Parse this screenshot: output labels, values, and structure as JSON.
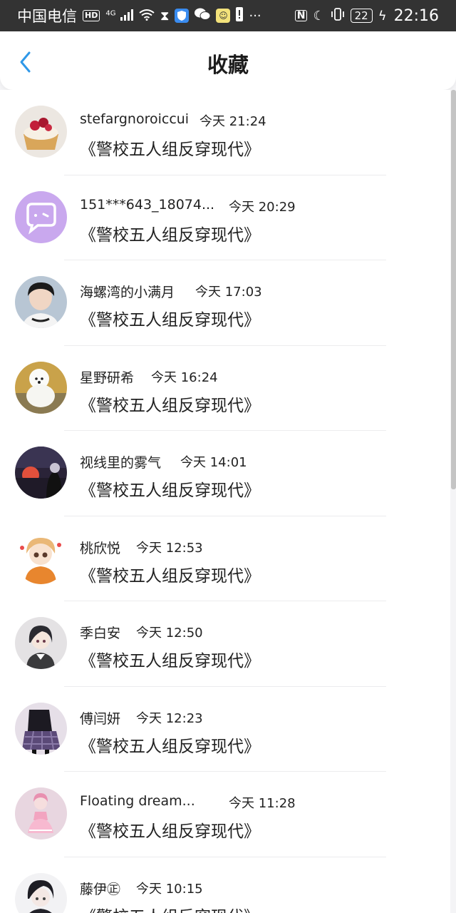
{
  "status_bar": {
    "carrier": "中国电信",
    "hd": "HD",
    "network": "4G",
    "battery": "22",
    "time": "22:16"
  },
  "header": {
    "title": "收藏",
    "back_icon": "chevron-left-icon"
  },
  "favorites": [
    {
      "name": "stefargnoroiccui",
      "time": "今天 21:24",
      "title": "《警校五人组反穿现代》",
      "avatar": "cupcake-avatar"
    },
    {
      "name": "151***643_18074...",
      "time": "今天 20:29",
      "title": "《警校五人组反穿现代》",
      "avatar": "default-chat-avatar"
    },
    {
      "name": "海螺湾的小满月",
      "time": "今天 17:03",
      "title": "《警校五人组反穿现代》",
      "avatar": "boy-photo-avatar"
    },
    {
      "name": "星野研希",
      "time": "今天 16:24",
      "title": "《警校五人组反穿现代》",
      "avatar": "white-dog-avatar"
    },
    {
      "name": "视线里的雾气",
      "time": "今天 14:01",
      "title": "《警校五人组反穿现代》",
      "avatar": "sunset-avatar"
    },
    {
      "name": "桃欣悦",
      "time": "今天 12:53",
      "title": "《警校五人组反穿现代》",
      "avatar": "anime-girl-orange-avatar"
    },
    {
      "name": "季白安",
      "time": "今天 12:50",
      "title": "《警校五人组反穿现代》",
      "avatar": "anime-boy-avatar"
    },
    {
      "name": "傅闫妍",
      "time": "今天 12:23",
      "title": "《警校五人组反穿现代》",
      "avatar": "plaid-skirt-avatar"
    },
    {
      "name": "Floating dream...",
      "time": "今天 11:28",
      "title": "《警校五人组反穿现代》",
      "avatar": "pink-doll-avatar"
    },
    {
      "name": "藤伊㊣",
      "time": "今天 10:15",
      "title": "《警校五人组反穿现代》",
      "avatar": "dark-hair-anime-avatar"
    }
  ]
}
